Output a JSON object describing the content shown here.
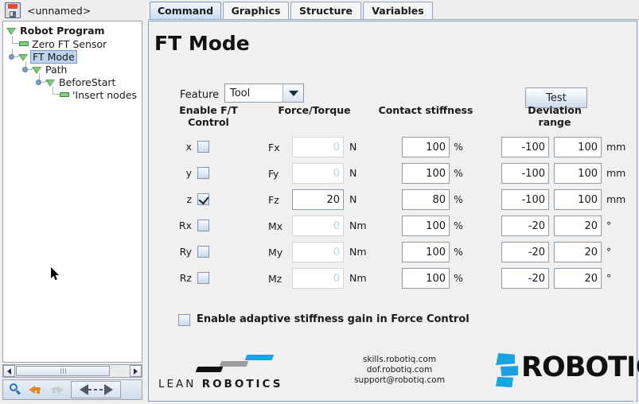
{
  "program": {
    "save_icon": "floppy-disk-icon",
    "name": "<unnamed>",
    "tree": [
      {
        "label": "Robot Program",
        "depth": 0,
        "marker": "triangle",
        "bold": true,
        "selected": false
      },
      {
        "label": "Zero FT Sensor",
        "depth": 1,
        "marker": "dash",
        "bold": false,
        "selected": false
      },
      {
        "label": "FT Mode",
        "depth": 1,
        "marker": "triangle",
        "bold": false,
        "selected": true
      },
      {
        "label": "Path",
        "depth": 2,
        "marker": "triangle",
        "bold": false,
        "selected": false
      },
      {
        "label": "BeforeStart",
        "depth": 3,
        "marker": "triangle",
        "bold": false,
        "selected": false
      },
      {
        "label": "'Insert nodes",
        "depth": 4,
        "marker": "dash",
        "bold": false,
        "selected": false
      }
    ],
    "toolbar": {
      "search": "search-magnifier-icon",
      "undo": "undo-arrow-icon",
      "redo": "redo-arrow-icon",
      "move": "move-node-icon"
    }
  },
  "tabs": [
    {
      "label": "Command",
      "active": true
    },
    {
      "label": "Graphics",
      "active": false
    },
    {
      "label": "Structure",
      "active": false
    },
    {
      "label": "Variables",
      "active": false
    }
  ],
  "page": {
    "title": "FT Mode",
    "feature_label": "Feature",
    "feature_value": "Tool",
    "feature_options": [
      "Tool"
    ],
    "test_button": "Test",
    "headers": {
      "enable": "Enable F/T\nControl",
      "enable_line1": "Enable F/T",
      "enable_line2": "Control",
      "force_torque": "Force/Torque",
      "contact_stiffness": "Contact stiffness",
      "deviation_line1": "Deviation",
      "deviation_line2": "range"
    },
    "rows": [
      {
        "axis": "x",
        "enabled": false,
        "ft_label": "Fx",
        "ft_value": "0",
        "ft_unit": "N",
        "stiffness": "100",
        "stiffness_unit": "%",
        "dev_min": "-100",
        "dev_max": "100",
        "dev_unit": "mm"
      },
      {
        "axis": "y",
        "enabled": false,
        "ft_label": "Fy",
        "ft_value": "0",
        "ft_unit": "N",
        "stiffness": "100",
        "stiffness_unit": "%",
        "dev_min": "-100",
        "dev_max": "100",
        "dev_unit": "mm"
      },
      {
        "axis": "z",
        "enabled": true,
        "ft_label": "Fz",
        "ft_value": "20",
        "ft_unit": "N",
        "stiffness": "80",
        "stiffness_unit": "%",
        "dev_min": "-100",
        "dev_max": "100",
        "dev_unit": "mm"
      },
      {
        "axis": "Rx",
        "enabled": false,
        "ft_label": "Mx",
        "ft_value": "0",
        "ft_unit": "Nm",
        "stiffness": "100",
        "stiffness_unit": "%",
        "dev_min": "-20",
        "dev_max": "20",
        "dev_unit": "°"
      },
      {
        "axis": "Ry",
        "enabled": false,
        "ft_label": "My",
        "ft_value": "0",
        "ft_unit": "Nm",
        "stiffness": "100",
        "stiffness_unit": "%",
        "dev_min": "-20",
        "dev_max": "20",
        "dev_unit": "°"
      },
      {
        "axis": "Rz",
        "enabled": false,
        "ft_label": "Mz",
        "ft_value": "0",
        "ft_unit": "Nm",
        "stiffness": "100",
        "stiffness_unit": "%",
        "dev_min": "-20",
        "dev_max": "20",
        "dev_unit": "°"
      }
    ],
    "adaptive": {
      "checked": false,
      "label": "Enable adaptive stiffness gain in Force Control"
    }
  },
  "footer": {
    "lean_text_lean": "LEAN",
    "lean_text_robotics": "ROBOTICS",
    "links": [
      "skills.robotiq.com",
      "dof.robotiq.com",
      "support@robotiq.com"
    ],
    "brand": "ROBOTIQ"
  },
  "colors": {
    "accent_blue": "#1aa3e0",
    "tab_active": "#c9dcf3",
    "selection": "#bdd3ee",
    "tree_node_green": "#86c486",
    "panel_bg": "#f0f0f0"
  }
}
